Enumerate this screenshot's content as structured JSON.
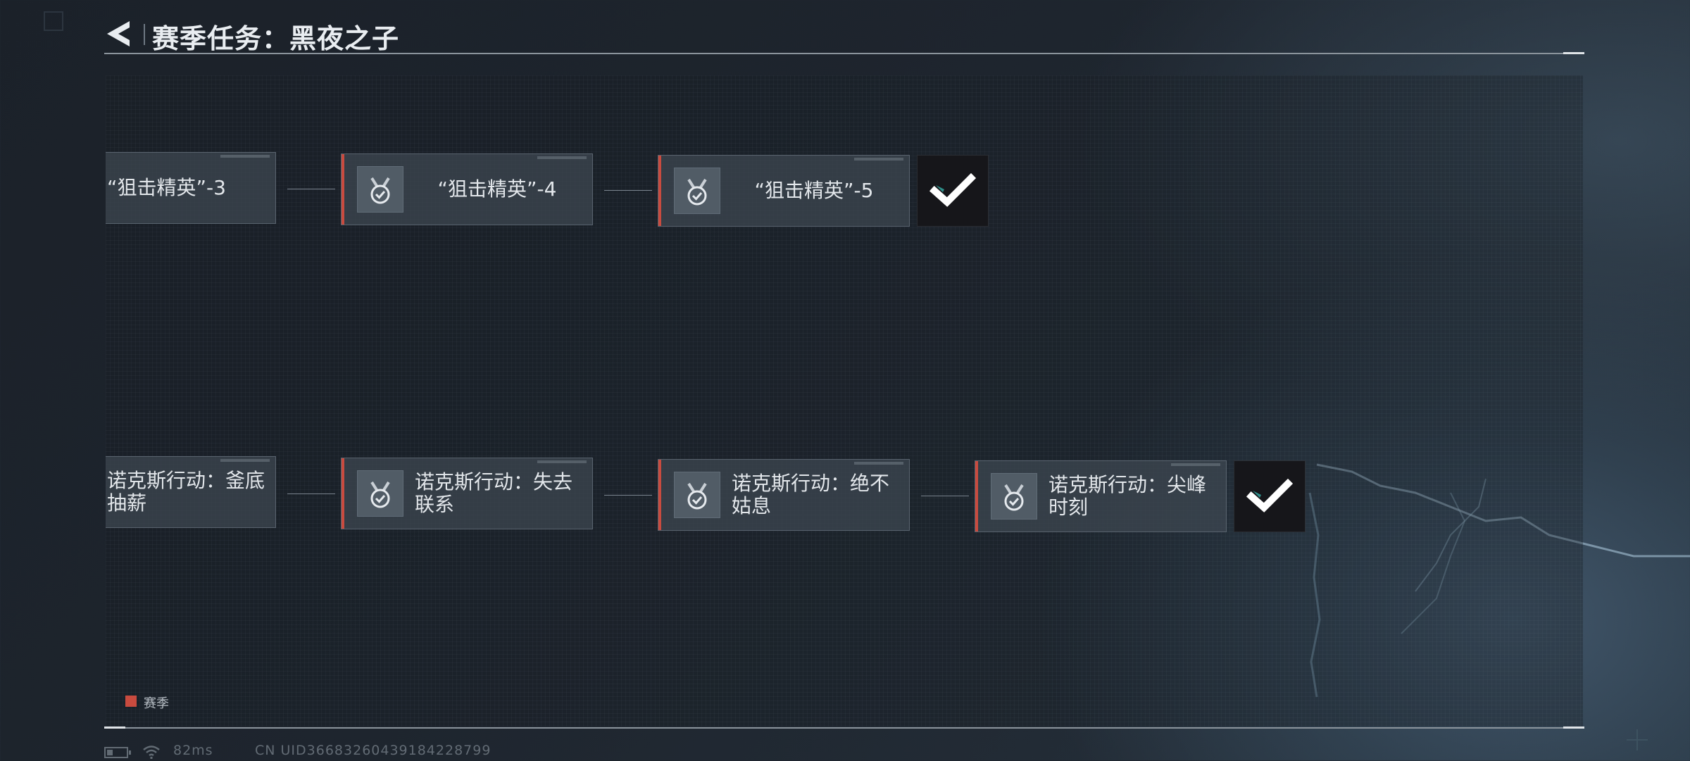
{
  "header": {
    "title": "赛季任务：黑夜之子"
  },
  "rows": [
    {
      "cards": [
        {
          "label": "“狙击精英”-3",
          "clipped": true
        },
        {
          "label": "“狙击精英”-4"
        },
        {
          "label": "“狙击精英”-5"
        }
      ],
      "completed": true
    },
    {
      "cards": [
        {
          "label": "诺克斯行动：釜底\n抽薪",
          "clipped": true
        },
        {
          "label": "诺克斯行动：失去\n联系"
        },
        {
          "label": "诺克斯行动：绝不\n姑息"
        },
        {
          "label": "诺克斯行动：尖峰\n时刻"
        }
      ],
      "completed": true
    }
  ],
  "legend": {
    "label": "赛季",
    "color": "#c94b3f"
  },
  "status_bar": {
    "ping": "82ms",
    "uid": "CN UID36683260439184228799",
    "battery_level": 0.3
  },
  "colors": {
    "accent": "#c94b3f",
    "card_bg": "#3e4852",
    "badge_bg": "#16161a"
  },
  "icons": {
    "back": "back-arrow-icon",
    "medal": "medal-check-icon",
    "complete": "checkmark-icon",
    "battery": "battery-icon",
    "wifi": "wifi-icon"
  }
}
